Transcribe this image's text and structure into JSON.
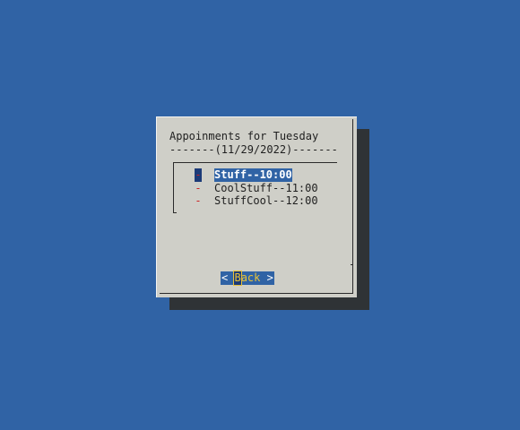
{
  "dialog": {
    "title": "Appoinments for Tuesday",
    "date_line": "-------(11/29/2022)-------"
  },
  "menu": {
    "items": [
      {
        "tag": "-",
        "label": "Stuff--10:00",
        "selected": true
      },
      {
        "tag": "-",
        "label": "CoolStuff--11:00",
        "selected": false
      },
      {
        "tag": "-",
        "label": "StuffCool--12:00",
        "selected": false
      }
    ]
  },
  "buttons": {
    "back": {
      "left_bracket": "<",
      "hotkey": "B",
      "rest": "ack",
      "right_bracket": ">"
    }
  },
  "colors": {
    "screen_background": "#3063a5",
    "dialog_background": "#cfcfc8",
    "shadow": "#2f3336",
    "selection": "#3063a5",
    "tag": "#cc2222",
    "hotkey": "#e8c23a"
  }
}
